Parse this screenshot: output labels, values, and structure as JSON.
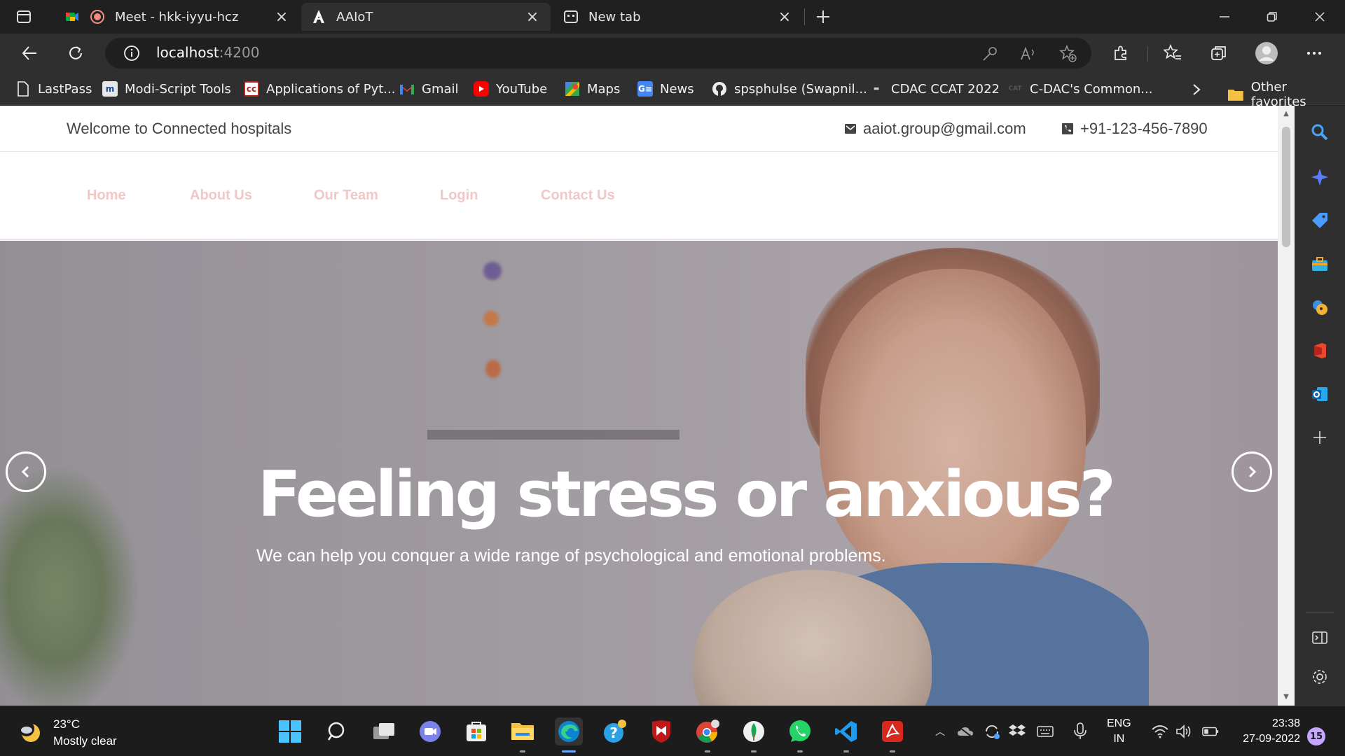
{
  "browser": {
    "tabs": [
      {
        "title": "Meet - hkk-iyyu-hcz",
        "favicon": "google-meet-icon"
      },
      {
        "title": "AAIoT",
        "favicon": "angular-icon",
        "active": true
      },
      {
        "title": "New tab",
        "favicon": "newtab-icon"
      }
    ],
    "address": {
      "host": "localhost",
      "port": ":4200"
    },
    "favorites": [
      {
        "label": "LastPass",
        "icon": "page-icon"
      },
      {
        "label": "Modi-Script Tools",
        "icon": "modi-icon"
      },
      {
        "label": "Applications of Pyt...",
        "icon": "cc-icon"
      },
      {
        "label": "Gmail",
        "icon": "gmail-icon"
      },
      {
        "label": "YouTube",
        "icon": "youtube-icon"
      },
      {
        "label": "Maps",
        "icon": "maps-icon"
      },
      {
        "label": "News",
        "icon": "news-icon"
      },
      {
        "label": "spsphulse (Swapnil...",
        "icon": "github-icon"
      },
      {
        "label": "CDAC CCAT 2022",
        "icon": "cdac-icon"
      },
      {
        "label": "C-DAC's Common...",
        "icon": "cdac-icon"
      }
    ],
    "other_favorites": "Other favorites"
  },
  "site": {
    "welcome": "Welcome to Connected hospitals",
    "email": "aaiot.group@gmail.com",
    "phone": "+91-123-456-7890",
    "nav": [
      "Home",
      "About Us",
      "Our Team",
      "Login",
      "Contact Us"
    ],
    "hero": {
      "title": "Feeling stress or anxious?",
      "subtitle": "We can help you conquer a wide range of psychological and emotional problems."
    },
    "colors": {
      "nav_link": "#f0c8c8"
    }
  },
  "taskbar": {
    "weather": {
      "temp": "23°C",
      "desc": "Mostly clear"
    },
    "language": {
      "line1": "ENG",
      "line2": "IN"
    },
    "clock": {
      "time": "23:38",
      "date": "27-09-2022"
    },
    "notifications": "15"
  }
}
